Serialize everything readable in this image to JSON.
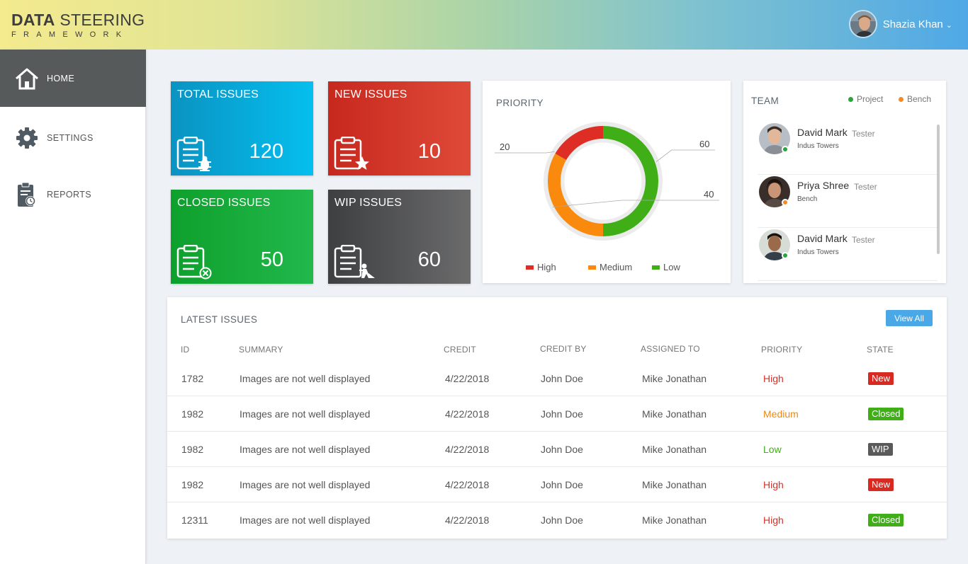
{
  "app": {
    "logo_bold": "DATA",
    "logo_rest": " STEERING",
    "logo_sub": "FRAMEWORK",
    "user_name": "Shazia Khan"
  },
  "sidebar": {
    "items": [
      {
        "label": "HOME",
        "icon": "home-icon",
        "active": true
      },
      {
        "label": "SETTINGS",
        "icon": "gear-icon",
        "active": false
      },
      {
        "label": "REPORTS",
        "icon": "clipboard-clock-icon",
        "active": false
      }
    ]
  },
  "tiles": {
    "total": {
      "title": "TOTAL ISSUES",
      "value": "120",
      "icon": "clipboard-bug-icon"
    },
    "new": {
      "title": "NEW ISSUES",
      "value": "10",
      "icon": "clipboard-star-icon"
    },
    "closed": {
      "title": "CLOSED ISSUES",
      "value": "50",
      "icon": "clipboard-x-icon"
    },
    "wip": {
      "title": "WIP ISSUES",
      "value": "60",
      "icon": "clipboard-worker-icon"
    }
  },
  "priority": {
    "title": "PRIORITY",
    "legend": [
      {
        "label": "High",
        "color": "#dd2d24"
      },
      {
        "label": "Medium",
        "color": "#f98a0d"
      },
      {
        "label": "Low",
        "color": "#3fae17"
      }
    ]
  },
  "chart_data": {
    "type": "pie",
    "title": "PRIORITY",
    "labels": [
      "High",
      "Medium",
      "Low"
    ],
    "values": [
      20,
      40,
      60
    ],
    "colors": [
      "#dd2d24",
      "#f98a0d",
      "#3fae17"
    ]
  },
  "team": {
    "title": "TEAM",
    "legend": [
      {
        "label": "Project",
        "color": "#2aa53a"
      },
      {
        "label": "Bench",
        "color": "#f58a2a"
      }
    ],
    "members": [
      {
        "name": "David Mark",
        "role": "Tester",
        "org": "Indus Towers",
        "status_color": "#2aa53a"
      },
      {
        "name": "Priya Shree",
        "role": "Tester",
        "org": "Bench",
        "status_color": "#f58a2a"
      },
      {
        "name": "David Mark",
        "role": "Tester",
        "org": "Indus Towers",
        "status_color": "#2aa53a"
      }
    ]
  },
  "issues": {
    "title": "LATEST ISSUES",
    "view_all": "View All",
    "columns": [
      "ID",
      "SUMMARY",
      "CREDIT",
      "CREDIT BY",
      "ASSIGNED TO",
      "PRIORITY",
      "STATE"
    ],
    "rows": [
      {
        "id": "1782",
        "summary": "Images are not well displayed",
        "credit": "4/22/2018",
        "credit_by": "John Doe",
        "assigned_to": "Mike Jonathan",
        "priority": "High",
        "priority_color": "#dd2d24",
        "state": "New",
        "state_color": "#d92a22"
      },
      {
        "id": "1982",
        "summary": "Images are not well displayed",
        "credit": "4/22/2018",
        "credit_by": "John Doe",
        "assigned_to": "Mike Jonathan",
        "priority": "Medium",
        "priority_color": "#f0880c",
        "state": "Closed",
        "state_color": "#3fae17"
      },
      {
        "id": "1982",
        "summary": "Images are not well displayed",
        "credit": "4/22/2018",
        "credit_by": "John Doe",
        "assigned_to": "Mike Jonathan",
        "priority": "Low",
        "priority_color": "#3fae17",
        "state": "WIP",
        "state_color": "#5a5a5a"
      },
      {
        "id": "1982",
        "summary": "Images are not well displayed",
        "credit": "4/22/2018",
        "credit_by": "John Doe",
        "assigned_to": "Mike Jonathan",
        "priority": "High",
        "priority_color": "#dd2d24",
        "state": "New",
        "state_color": "#d92a22"
      },
      {
        "id": "12311",
        "summary": "Images are not well displayed",
        "credit": "4/22/2018",
        "credit_by": "John Doe",
        "assigned_to": "Mike Jonathan",
        "priority": "High",
        "priority_color": "#dd2d24",
        "state": "Closed",
        "state_color": "#3fae17"
      }
    ]
  }
}
